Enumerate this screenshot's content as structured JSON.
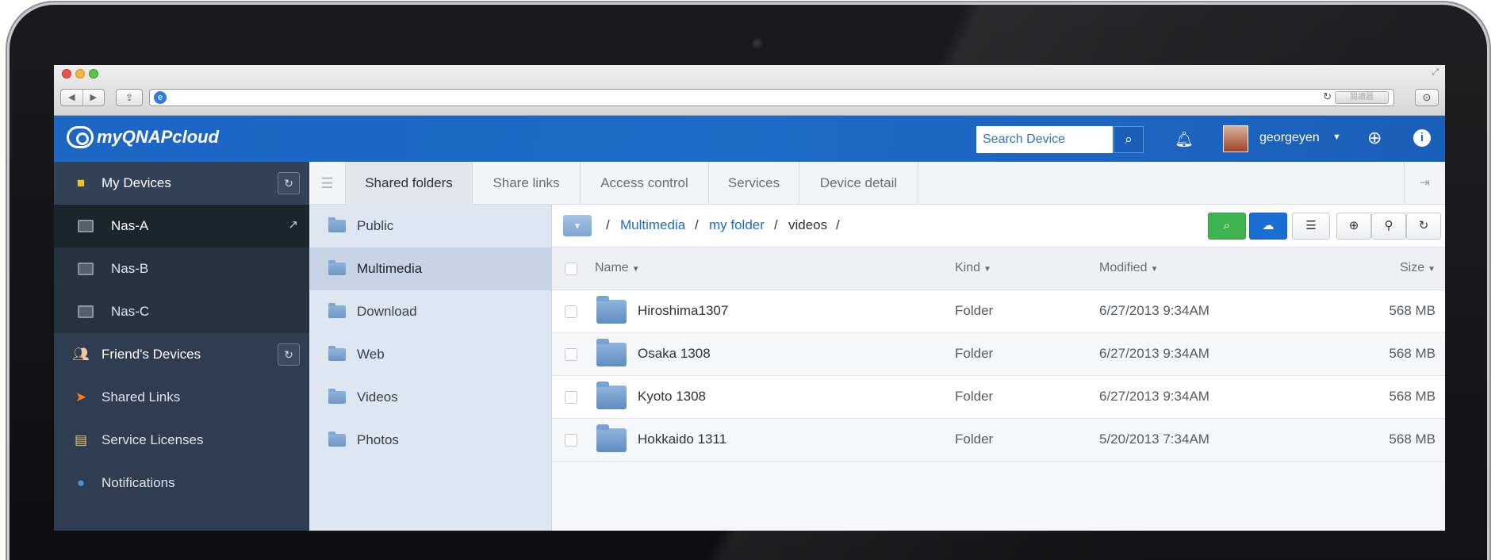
{
  "browser": {
    "reader_label": "閱讀器",
    "url": ""
  },
  "app": {
    "logo_text": "myQNAPcloud",
    "search_placeholder": "Search Device",
    "username": "georgeyen"
  },
  "sidebar": {
    "my_devices_label": "My Devices",
    "devices": [
      {
        "label": "Nas-A",
        "active": true
      },
      {
        "label": "Nas-B",
        "active": false
      },
      {
        "label": "Nas-C",
        "active": false
      }
    ],
    "items": [
      {
        "label": "Friend's Devices"
      },
      {
        "label": "Shared Links"
      },
      {
        "label": "Service Licenses"
      },
      {
        "label": "Notifications"
      }
    ]
  },
  "tabs": [
    {
      "label": "Shared folders",
      "active": true
    },
    {
      "label": "Share links",
      "active": false
    },
    {
      "label": "Access control",
      "active": false
    },
    {
      "label": "Services",
      "active": false
    },
    {
      "label": "Device detail",
      "active": false
    }
  ],
  "folders": [
    {
      "label": "Public",
      "active": false
    },
    {
      "label": "Multimedia",
      "active": true
    },
    {
      "label": "Download",
      "active": false
    },
    {
      "label": "Web",
      "active": false
    },
    {
      "label": "Videos",
      "active": false
    },
    {
      "label": "Photos",
      "active": false
    }
  ],
  "breadcrumb": {
    "sep": "/",
    "items": [
      "Multimedia",
      "my folder",
      "videos"
    ]
  },
  "columns": {
    "name": "Name",
    "kind": "Kind",
    "modified": "Modified",
    "size": "Size"
  },
  "files": [
    {
      "name": "Hiroshima1307",
      "kind": "Folder",
      "modified": "6/27/2013 9:34AM",
      "size": "568 MB"
    },
    {
      "name": "Osaka 1308",
      "kind": "Folder",
      "modified": "6/27/2013 9:34AM",
      "size": "568 MB"
    },
    {
      "name": "Kyoto 1308",
      "kind": "Folder",
      "modified": "6/27/2013 9:34AM",
      "size": "568 MB"
    },
    {
      "name": "Hokkaido 1311",
      "kind": "Folder",
      "modified": "5/20/2013 7:34AM",
      "size": "568 MB"
    }
  ],
  "colors": {
    "header_blue": "#1c66c4",
    "sidebar": "#2e3d52",
    "link": "#1e6bc8",
    "green_button": "#3fb34f"
  },
  "icons": {
    "search": "search-icon",
    "bell": "bell-icon",
    "globe": "globe-icon",
    "info": "info-icon",
    "refresh": "refresh-icon",
    "external": "external-link-icon",
    "logout": "logout-icon"
  }
}
